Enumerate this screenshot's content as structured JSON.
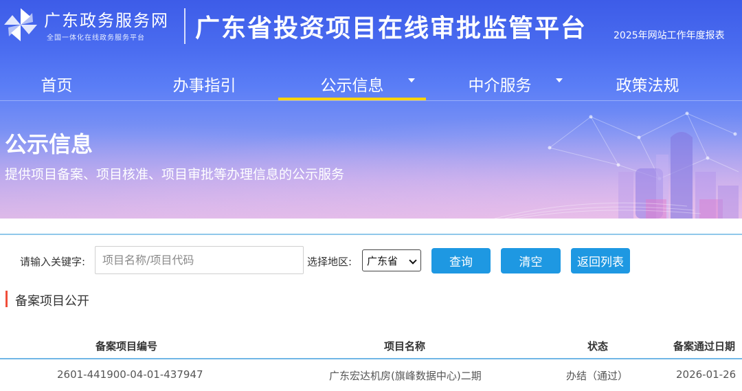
{
  "header": {
    "logo_title": "广东政务服务网",
    "logo_subtitle": "全国一体化在线政务服务平台",
    "platform_title": "广东省投资项目在线审批监管平台",
    "report_link": "2025年网站工作年度报表"
  },
  "nav": {
    "items": [
      {
        "label": "首页"
      },
      {
        "label": "办事指引"
      },
      {
        "label": "公示信息"
      },
      {
        "label": "中介服务"
      },
      {
        "label": "政策法规"
      }
    ],
    "active": "公示信息"
  },
  "banner": {
    "title": "公示信息",
    "description": "提供项目备案、项目核准、项目审批等办理信息的公示服务"
  },
  "search": {
    "keyword_label": "请输入关键字:",
    "keyword_placeholder": "项目名称/项目代码",
    "keyword_value": "",
    "region_label": "选择地区:",
    "region_value": "广东省",
    "query_button": "查询",
    "clear_button": "清空",
    "back_button": "返回列表"
  },
  "section": {
    "title": "备案项目公开"
  },
  "table": {
    "columns": [
      "备案项目编号",
      "项目名称",
      "状态",
      "备案通过日期"
    ],
    "rows": [
      {
        "code": "2601-441900-04-01-437947",
        "name": "广东宏达机房(旗峰数据中心)二期",
        "status": "办结（通过）",
        "date": "2026-01-26"
      }
    ]
  },
  "colors": {
    "accent_blue": "#1e98e2",
    "nav_active_underline": "#ffd400",
    "section_marker": "#f04e3a",
    "table_rule": "#6fb6e6"
  }
}
